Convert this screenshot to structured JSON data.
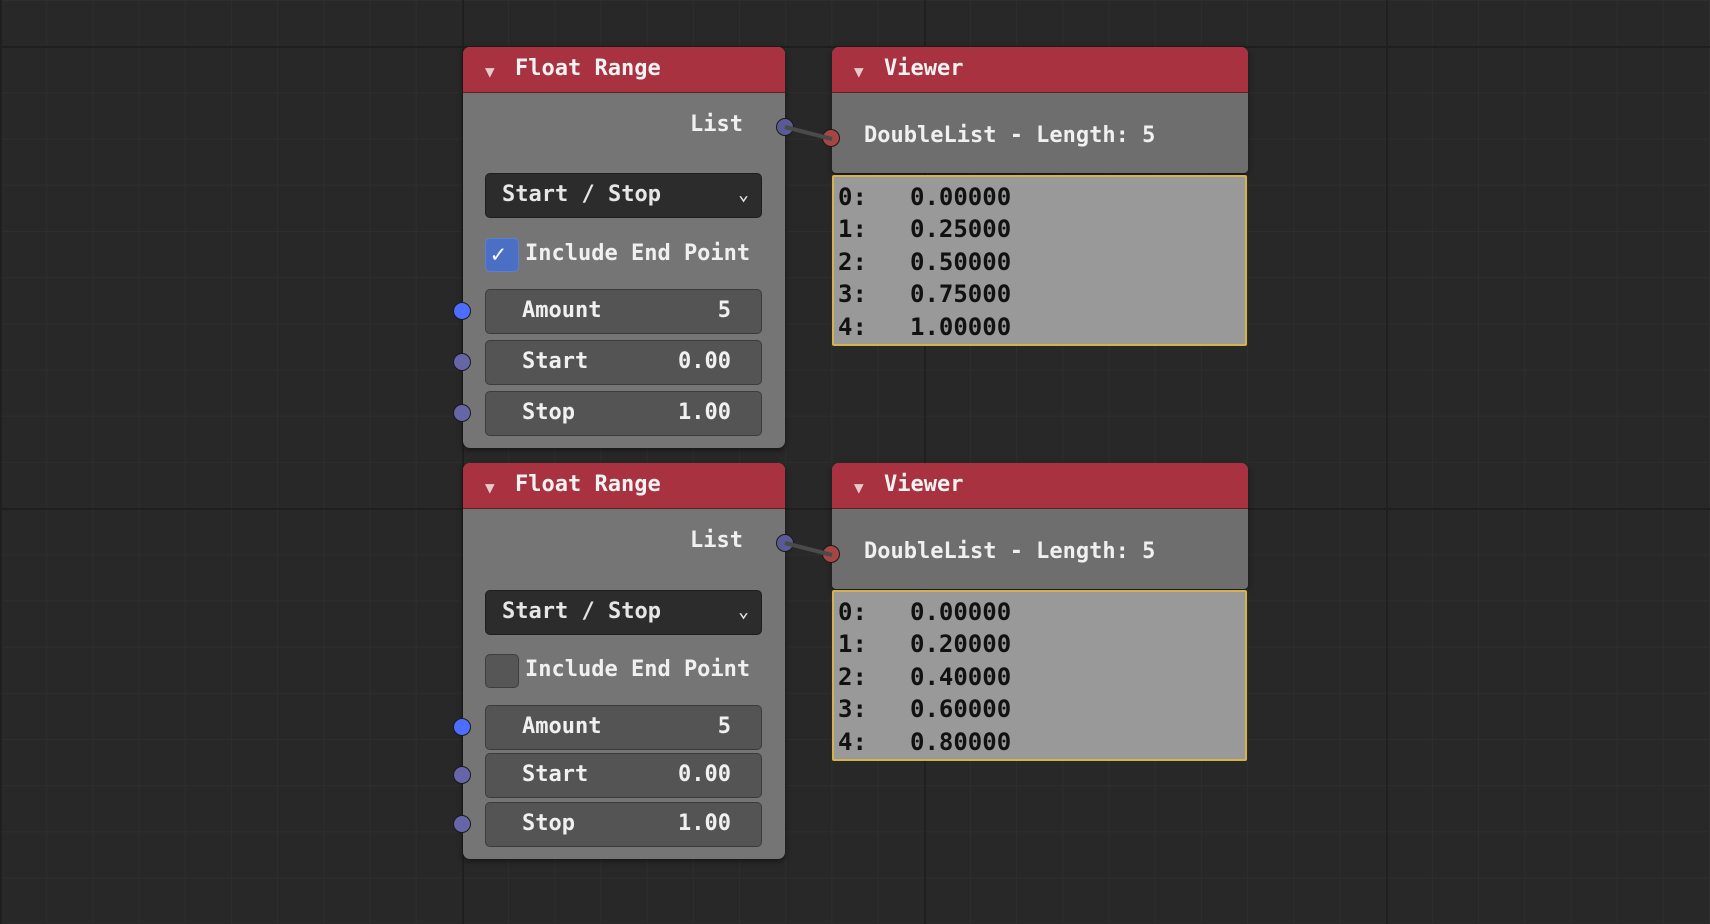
{
  "nodes": [
    {
      "title": "Float Range",
      "output_label": "List",
      "mode": "Start / Stop",
      "include_end_point": {
        "label": "Include End Point",
        "checked": true
      },
      "fields": [
        {
          "name": "Amount",
          "value": "5"
        },
        {
          "name": "Start",
          "value": "0.00"
        },
        {
          "name": "Stop",
          "value": "1.00"
        }
      ],
      "viewer": {
        "title": "Viewer",
        "summary": "DoubleList - Length: 5",
        "rows": [
          {
            "index": "0:",
            "value": "0.00000"
          },
          {
            "index": "1:",
            "value": "0.25000"
          },
          {
            "index": "2:",
            "value": "0.50000"
          },
          {
            "index": "3:",
            "value": "0.75000"
          },
          {
            "index": "4:",
            "value": "1.00000"
          }
        ]
      }
    },
    {
      "title": "Float Range",
      "output_label": "List",
      "mode": "Start / Stop",
      "include_end_point": {
        "label": "Include End Point",
        "checked": false
      },
      "fields": [
        {
          "name": "Amount",
          "value": "5"
        },
        {
          "name": "Start",
          "value": "0.00"
        },
        {
          "name": "Stop",
          "value": "1.00"
        }
      ],
      "viewer": {
        "title": "Viewer",
        "summary": "DoubleList - Length: 5",
        "rows": [
          {
            "index": "0:",
            "value": "0.00000"
          },
          {
            "index": "1:",
            "value": "0.20000"
          },
          {
            "index": "2:",
            "value": "0.40000"
          },
          {
            "index": "3:",
            "value": "0.60000"
          },
          {
            "index": "4:",
            "value": "0.80000"
          }
        ]
      }
    }
  ],
  "colors": {
    "header": "#a8323f",
    "node_body": "#757575",
    "socket_integer": "#4d6dff",
    "socket_float": "#6565a8",
    "socket_viewer_input": "#a64545",
    "list_panel_border": "#d6b24a",
    "checkbox_on": "#4a6fc4"
  },
  "icons": [
    "collapse-triangle-icon",
    "chevron-down-icon",
    "checkmark-icon"
  ]
}
